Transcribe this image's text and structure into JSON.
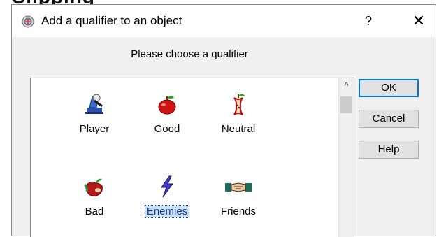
{
  "window": {
    "title": "Add a qualifier to an object",
    "help_glyph": "?",
    "close_glyph": "✕"
  },
  "prompt": "Please choose a qualifier",
  "qualifiers": [
    {
      "label": "Player",
      "icon": "player-icon",
      "selected": false
    },
    {
      "label": "Good",
      "icon": "red-apple-icon",
      "selected": false
    },
    {
      "label": "Neutral",
      "icon": "apple-core-icon",
      "selected": false
    },
    {
      "label": "Bad",
      "icon": "bitten-apple-icon",
      "selected": false
    },
    {
      "label": "Enemies",
      "icon": "lightning-icon",
      "selected": true
    },
    {
      "label": "Friends",
      "icon": "handshake-icon",
      "selected": false
    }
  ],
  "buttons": {
    "ok": "OK",
    "cancel": "Cancel",
    "help": "Help"
  },
  "scrollbar": {
    "up_glyph": "^"
  },
  "colors": {
    "dialog_bg": "#f0f0f0",
    "selection_bg": "#cce0f8",
    "selection_text": "#0b3d8a",
    "default_button_border": "#0078d7"
  }
}
